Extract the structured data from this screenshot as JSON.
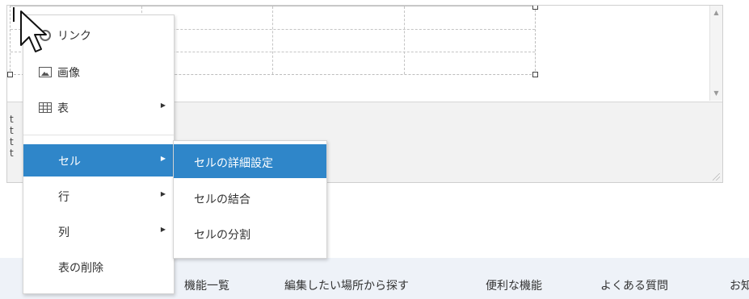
{
  "context_menu": {
    "items": [
      {
        "label": "リンク",
        "icon": "link-icon"
      },
      {
        "label": "画像",
        "icon": "image-icon"
      },
      {
        "label": "表",
        "icon": "table-icon",
        "has_submenu": true
      },
      {
        "label": "セル",
        "has_submenu": true,
        "active": true
      },
      {
        "label": "行",
        "has_submenu": true
      },
      {
        "label": "列",
        "has_submenu": true
      },
      {
        "label": "表の削除"
      }
    ],
    "submenu_arrow": "▶"
  },
  "cell_submenu": {
    "items": [
      {
        "label": "セルの詳細設定",
        "active": true
      },
      {
        "label": "セルの結合"
      },
      {
        "label": "セルの分割"
      }
    ]
  },
  "editor": {
    "source_lines": [
      "t",
      "t",
      "t",
      "t"
    ],
    "scroll_up": "▲",
    "scroll_down": "▼"
  },
  "bottom_nav": {
    "links": [
      "機能一覧",
      "編集したい場所から探す",
      "便利な機能",
      "よくある質問",
      "お知"
    ]
  },
  "colors": {
    "highlight": "#2f86c9",
    "nav_background": "#eef2f8"
  }
}
